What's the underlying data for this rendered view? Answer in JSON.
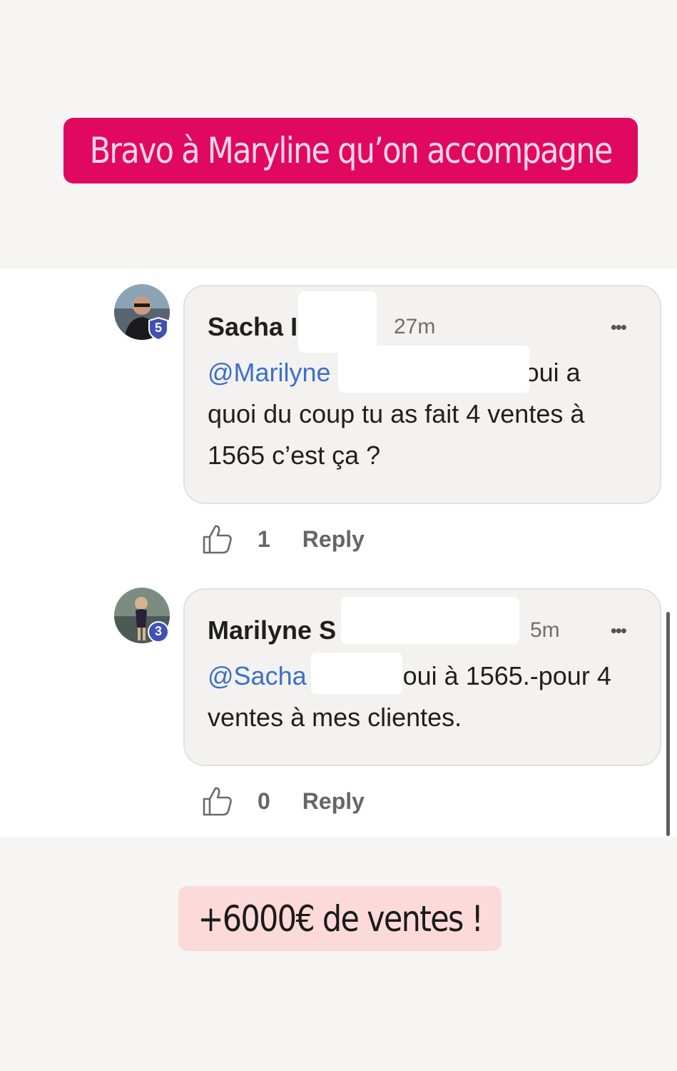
{
  "top_banner": {
    "text": "Bravo à Maryline qu’on accompagne"
  },
  "comments": [
    {
      "author": "Sacha",
      "author_partial": "I",
      "time": "27m",
      "level": "5",
      "mention": "@Marilyne",
      "body_first": "oui a",
      "body_rest": "quoi du coup tu as fait 4 ventes à 1565 c’est ça ?",
      "like_count": "1",
      "reply_label": "Reply",
      "more": "•••"
    },
    {
      "author": "Marilyne",
      "author_partial": "S",
      "time": "5m",
      "level": "3",
      "mention": "@Sacha",
      "body_first": "oui à 1565.-pour 4",
      "body_rest": "ventes à mes clientes.",
      "like_count": "0",
      "reply_label": "Reply",
      "more": "•••"
    }
  ],
  "bottom_banner": {
    "text": "+6000€ de ventes !"
  },
  "colors": {
    "banner_pink": "#e1085f",
    "banner_light": "#fddada",
    "mention_blue": "#3e6fc5",
    "badge_blue": "#3f51b5"
  }
}
